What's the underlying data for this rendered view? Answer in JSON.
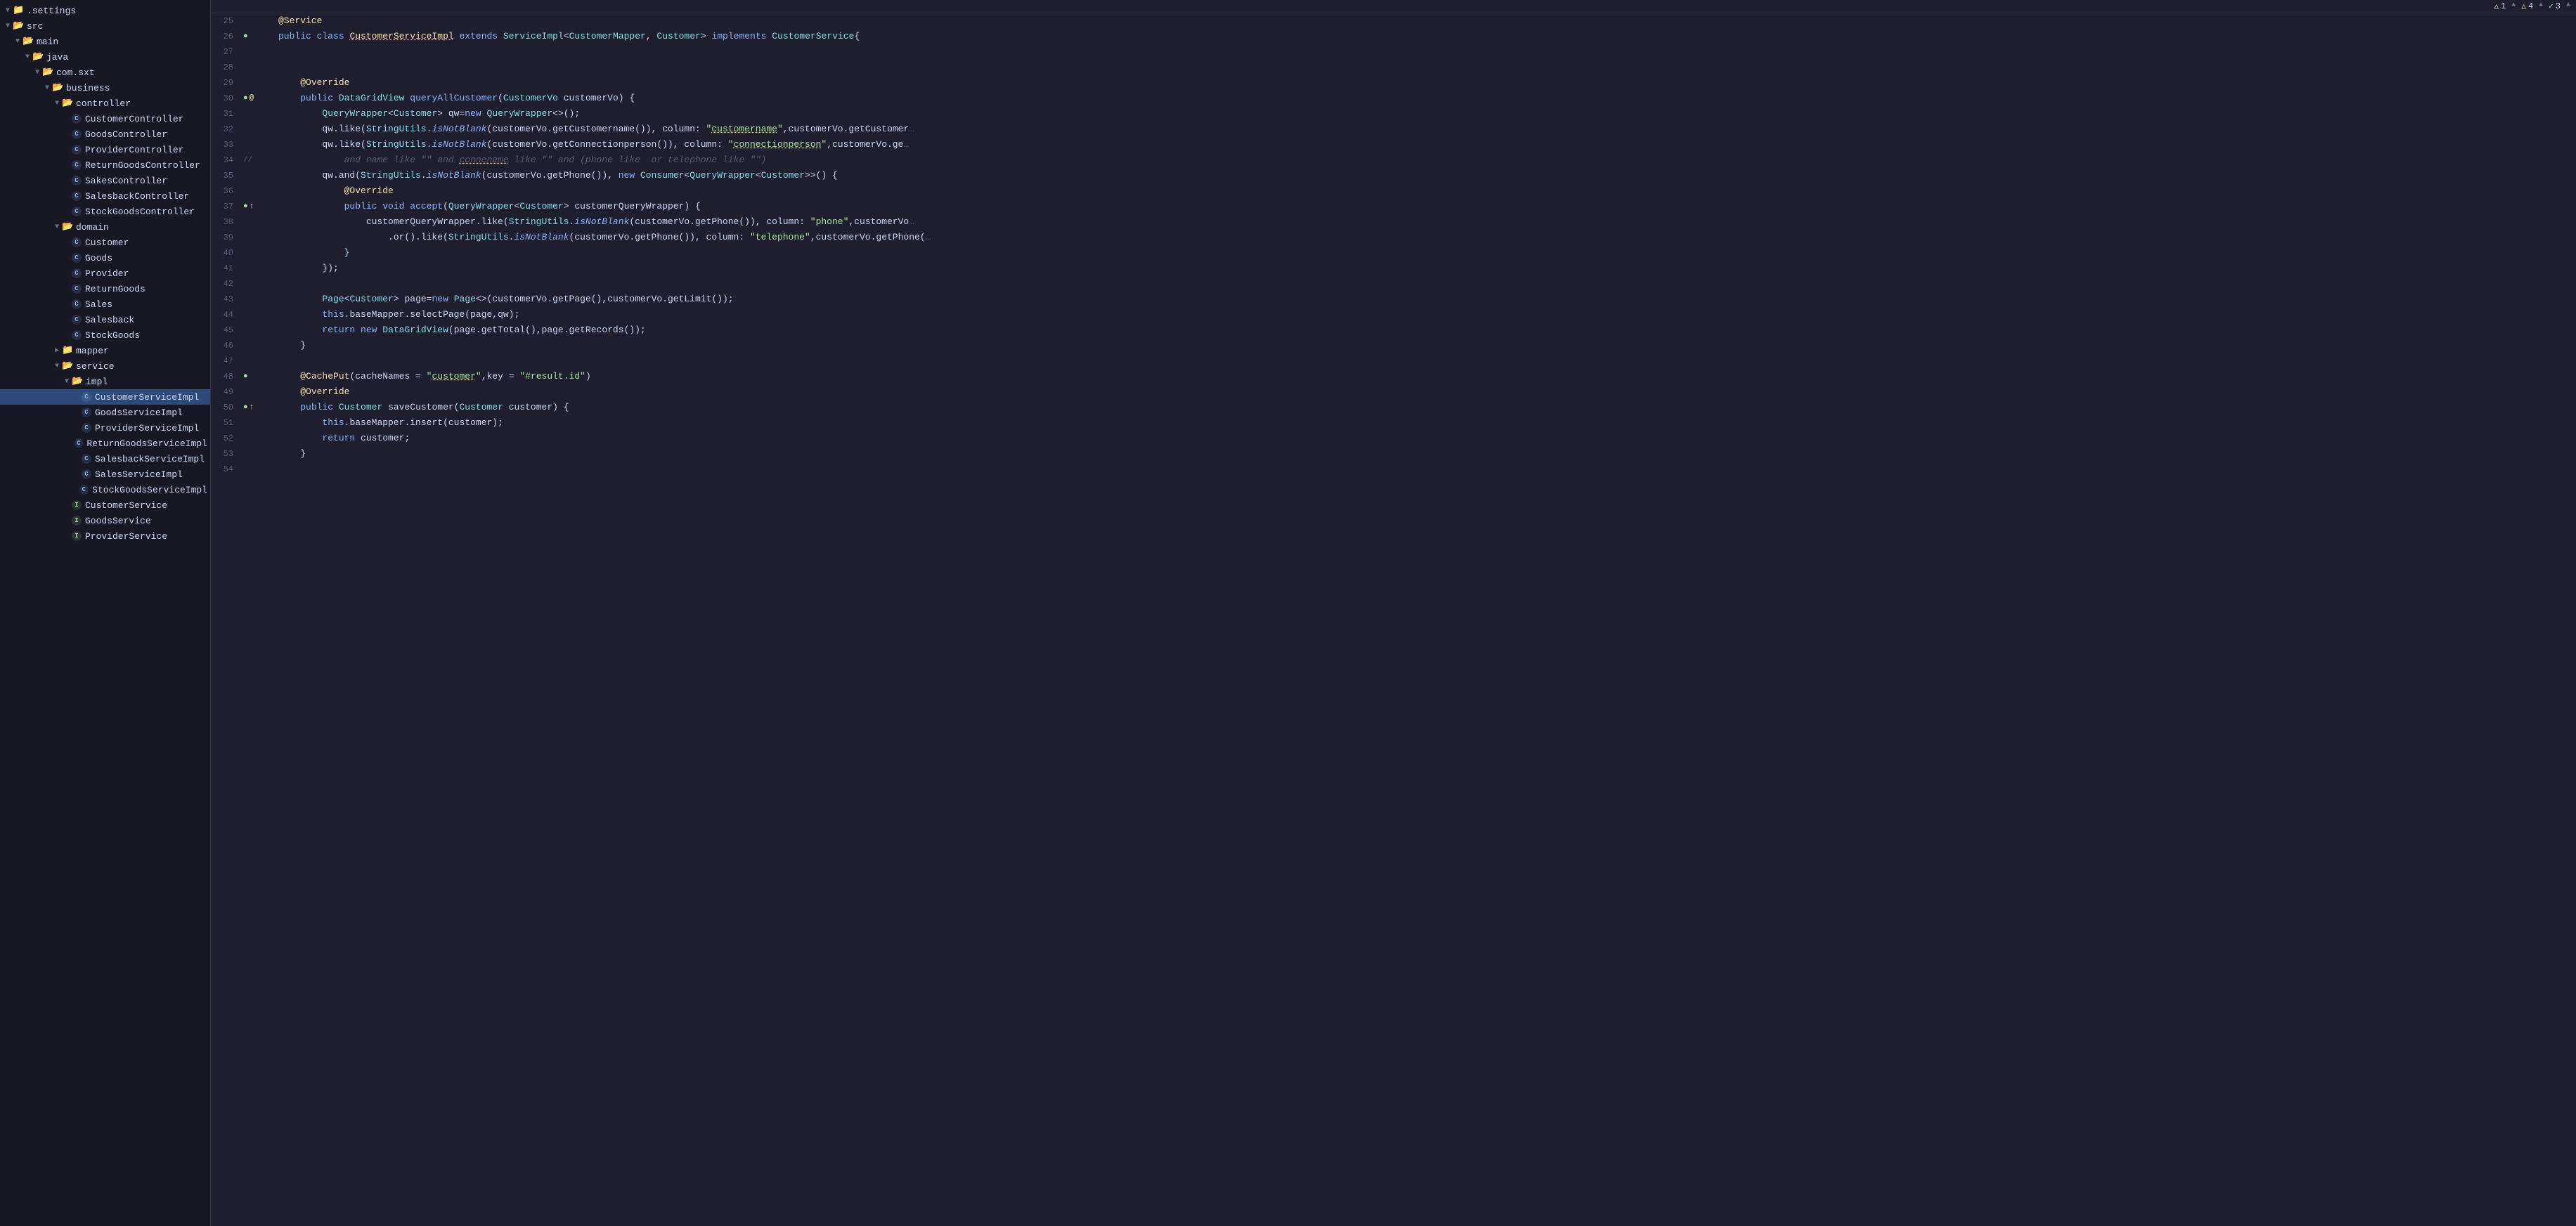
{
  "sidebar": {
    "items": [
      {
        "id": "settings",
        "label": ".settings",
        "indent": 0,
        "type": "folder",
        "expanded": false,
        "arrow": "▼"
      },
      {
        "id": "src",
        "label": "src",
        "indent": 0,
        "type": "folder",
        "expanded": true,
        "arrow": "▼"
      },
      {
        "id": "main",
        "label": "main",
        "indent": 1,
        "type": "folder",
        "expanded": true,
        "arrow": "▼"
      },
      {
        "id": "java",
        "label": "java",
        "indent": 2,
        "type": "folder",
        "expanded": true,
        "arrow": "▼"
      },
      {
        "id": "com.sxt",
        "label": "com.sxt",
        "indent": 3,
        "type": "folder",
        "expanded": true,
        "arrow": "▼"
      },
      {
        "id": "business",
        "label": "business",
        "indent": 4,
        "type": "folder",
        "expanded": true,
        "arrow": "▼"
      },
      {
        "id": "controller",
        "label": "controller",
        "indent": 5,
        "type": "folder",
        "expanded": true,
        "arrow": "▼"
      },
      {
        "id": "CustomerController",
        "label": "CustomerController",
        "indent": 6,
        "type": "class",
        "arrow": ""
      },
      {
        "id": "GoodsController",
        "label": "GoodsController",
        "indent": 6,
        "type": "class",
        "arrow": ""
      },
      {
        "id": "ProviderController",
        "label": "ProviderController",
        "indent": 6,
        "type": "class",
        "arrow": ""
      },
      {
        "id": "ReturnGoodsController",
        "label": "ReturnGoodsController",
        "indent": 6,
        "type": "class",
        "arrow": ""
      },
      {
        "id": "SakesController",
        "label": "SakesController",
        "indent": 6,
        "type": "class",
        "arrow": ""
      },
      {
        "id": "SalesbackController",
        "label": "SalesbackController",
        "indent": 6,
        "type": "class",
        "arrow": ""
      },
      {
        "id": "StockGoodsController",
        "label": "StockGoodsController",
        "indent": 6,
        "type": "class",
        "arrow": ""
      },
      {
        "id": "domain",
        "label": "domain",
        "indent": 5,
        "type": "folder",
        "expanded": true,
        "arrow": "▼"
      },
      {
        "id": "Customer",
        "label": "Customer",
        "indent": 6,
        "type": "class",
        "arrow": ""
      },
      {
        "id": "Goods",
        "label": "Goods",
        "indent": 6,
        "type": "class",
        "arrow": ""
      },
      {
        "id": "Provider",
        "label": "Provider",
        "indent": 6,
        "type": "class",
        "arrow": ""
      },
      {
        "id": "ReturnGoods",
        "label": "ReturnGoods",
        "indent": 6,
        "type": "class",
        "arrow": ""
      },
      {
        "id": "Sales",
        "label": "Sales",
        "indent": 6,
        "type": "class",
        "arrow": ""
      },
      {
        "id": "Salesback",
        "label": "Salesback",
        "indent": 6,
        "type": "class",
        "arrow": ""
      },
      {
        "id": "StockGoods",
        "label": "StockGoods",
        "indent": 6,
        "type": "class",
        "arrow": ""
      },
      {
        "id": "mapper",
        "label": "mapper",
        "indent": 5,
        "type": "folder",
        "expanded": false,
        "arrow": "▶"
      },
      {
        "id": "service",
        "label": "service",
        "indent": 5,
        "type": "folder",
        "expanded": true,
        "arrow": "▼"
      },
      {
        "id": "impl",
        "label": "impl",
        "indent": 6,
        "type": "folder",
        "expanded": true,
        "arrow": "▼"
      },
      {
        "id": "CustomerServiceImpl",
        "label": "CustomerServiceImpl",
        "indent": 7,
        "type": "class",
        "selected": true,
        "arrow": ""
      },
      {
        "id": "GoodsServiceImpl",
        "label": "GoodsServiceImpl",
        "indent": 7,
        "type": "class",
        "arrow": ""
      },
      {
        "id": "ProviderServiceImpl",
        "label": "ProviderServiceImpl",
        "indent": 7,
        "type": "class",
        "arrow": ""
      },
      {
        "id": "ReturnGoodsServiceImpl",
        "label": "ReturnGoodsServiceImpl",
        "indent": 7,
        "type": "class",
        "arrow": ""
      },
      {
        "id": "SalesbackServiceImpl",
        "label": "SalesbackServiceImpl",
        "indent": 7,
        "type": "class",
        "arrow": ""
      },
      {
        "id": "SalesServiceImpl",
        "label": "SalesServiceImpl",
        "indent": 7,
        "type": "class",
        "arrow": ""
      },
      {
        "id": "StockGoodsServiceImpl",
        "label": "StockGoodsServiceImpl",
        "indent": 7,
        "type": "class",
        "arrow": ""
      },
      {
        "id": "CustomerService",
        "label": "CustomerService",
        "indent": 6,
        "type": "interface",
        "arrow": ""
      },
      {
        "id": "GoodsService",
        "label": "GoodsService",
        "indent": 6,
        "type": "interface",
        "arrow": ""
      },
      {
        "id": "ProviderService",
        "label": "ProviderService",
        "indent": 6,
        "type": "interface",
        "arrow": ""
      }
    ]
  },
  "editor": {
    "warnings": [
      {
        "icon": "△",
        "count": "1",
        "type": "warn"
      },
      {
        "icon": "△",
        "count": "4",
        "type": "warn"
      },
      {
        "icon": "✓",
        "count": "3",
        "type": "ok"
      }
    ],
    "lines": [
      {
        "num": 25,
        "gutter": "",
        "code": "@Service"
      },
      {
        "num": 26,
        "gutter": "●",
        "code": "public class CustomerServiceImpl extends ServiceImpl<CustomerMapper, Customer> implements CustomerService{"
      },
      {
        "num": 27,
        "gutter": "",
        "code": ""
      },
      {
        "num": 28,
        "gutter": "",
        "code": ""
      },
      {
        "num": 29,
        "gutter": "",
        "code": "    @Override"
      },
      {
        "num": 30,
        "gutter": "●@",
        "code": "    public DataGridView queryAllCustomer(CustomerVo customerVo) {"
      },
      {
        "num": 31,
        "gutter": "",
        "code": "        QueryWrapper<Customer> qw=new QueryWrapper<>();"
      },
      {
        "num": 32,
        "gutter": "",
        "code": "        qw.like(StringUtils.isNotBlank(customerVo.getCustomername()), column: \"customername\",customerVo.getCustomer"
      },
      {
        "num": 33,
        "gutter": "",
        "code": "        qw.like(StringUtils.isNotBlank(customerVo.getConnectionperson()), column: \"connectionperson\",customerVo.ge"
      },
      {
        "num": 34,
        "gutter": "//",
        "code": "            and name like \"\" and connename like \"\" and (phone like  or telephone like \"\")"
      },
      {
        "num": 35,
        "gutter": "",
        "code": "        qw.and(StringUtils.isNotBlank(customerVo.getPhone()), new Consumer<QueryWrapper<Customer>>() {"
      },
      {
        "num": 36,
        "gutter": "",
        "code": "            @Override"
      },
      {
        "num": 37,
        "gutter": "●↑",
        "code": "            public void accept(QueryWrapper<Customer> customerQueryWrapper) {"
      },
      {
        "num": 38,
        "gutter": "",
        "code": "                customerQueryWrapper.like(StringUtils.isNotBlank(customerVo.getPhone()), column: \"phone\",customerVo"
      },
      {
        "num": 39,
        "gutter": "",
        "code": "                    .or().like(StringUtils.isNotBlank(customerVo.getPhone()), column: \"telephone\",customerVo.getPhone("
      },
      {
        "num": 40,
        "gutter": "",
        "code": "            }"
      },
      {
        "num": 41,
        "gutter": "",
        "code": "        });"
      },
      {
        "num": 42,
        "gutter": "",
        "code": ""
      },
      {
        "num": 43,
        "gutter": "",
        "code": "        Page<Customer> page=new Page<>(customerVo.getPage(),customerVo.getLimit());"
      },
      {
        "num": 44,
        "gutter": "",
        "code": "        this.baseMapper.selectPage(page,qw);"
      },
      {
        "num": 45,
        "gutter": "",
        "code": "        return new DataGridView(page.getTotal(),page.getRecords());"
      },
      {
        "num": 46,
        "gutter": "",
        "code": "    }"
      },
      {
        "num": 47,
        "gutter": "",
        "code": ""
      },
      {
        "num": 48,
        "gutter": "●",
        "code": "    @CachePut(cacheNames = \"customer\",key = \"#result.id\")"
      },
      {
        "num": 49,
        "gutter": "",
        "code": "    @Override"
      },
      {
        "num": 50,
        "gutter": "●↑",
        "code": "    public Customer saveCustomer(Customer customer) {"
      },
      {
        "num": 51,
        "gutter": "",
        "code": "        this.baseMapper.insert(customer);"
      },
      {
        "num": 52,
        "gutter": "",
        "code": "        return customer;"
      },
      {
        "num": 53,
        "gutter": "",
        "code": "    }"
      },
      {
        "num": 54,
        "gutter": "",
        "code": ""
      }
    ]
  }
}
